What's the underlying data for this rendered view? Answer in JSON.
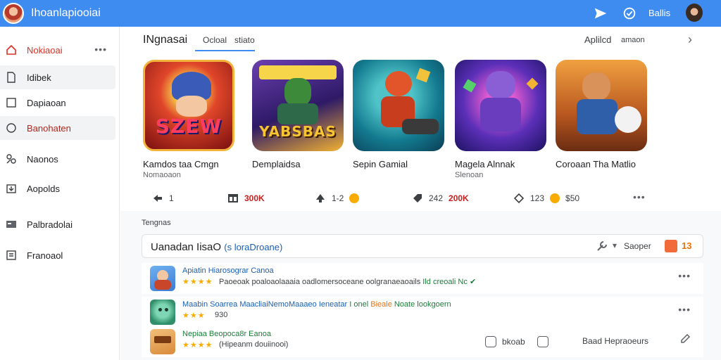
{
  "app": {
    "title": "Ihoanlapiooiai"
  },
  "topbar": {
    "label": "Ballis"
  },
  "sidebar": {
    "items": [
      {
        "label": "Nokiaoai",
        "icon": "home-icon"
      },
      {
        "label": "Idibek",
        "icon": "document-icon"
      },
      {
        "label": "Dapiaoan",
        "icon": "square-icon"
      },
      {
        "label": "Banohaten",
        "icon": "circle-icon"
      },
      {
        "label": "Naonos",
        "icon": "people-icon"
      },
      {
        "label": "Aopolds",
        "icon": "download-box-icon"
      },
      {
        "label": "Palbradolai",
        "icon": "card-icon"
      },
      {
        "label": "Franoaol",
        "icon": "list-box-icon"
      }
    ]
  },
  "main": {
    "section_title": "INgnasai",
    "tabs": [
      "Ocloal",
      "stiato"
    ],
    "right_links": [
      "Aplilcd",
      "amaon"
    ],
    "cards": [
      {
        "name": "Kamdos taa Cmgn",
        "sub": "Nomaoaon",
        "art": "SZEW",
        "colors": [
          "#b01818",
          "#f2a23a"
        ]
      },
      {
        "name": "Demplaidsa",
        "sub": "",
        "art": "YABSBAS",
        "colors": [
          "#4b2a8c",
          "#f7c531"
        ]
      },
      {
        "name": "Sepin Gamial",
        "sub": "",
        "art": "",
        "colors": [
          "#0c6e8e",
          "#f08b2a"
        ]
      },
      {
        "name": "Magela Alnnak",
        "sub": "Slenoan",
        "art": "",
        "colors": [
          "#3a1e8c",
          "#d54ab6"
        ]
      },
      {
        "name": "Coroaan Tha Matlio",
        "sub": "",
        "art": "",
        "colors": [
          "#d7762a",
          "#4a8bd6"
        ]
      }
    ],
    "stats": [
      {
        "icon": "arrow-icon",
        "value": "1",
        "color": "#3c4043"
      },
      {
        "icon": "grid-icon",
        "value": "300K",
        "color": "#c5221f"
      },
      {
        "icon": "up-arrow-icon",
        "value": "1-2",
        "color": "#3c4043"
      },
      {
        "icon": "tag-icon",
        "value": "242",
        "color": "#3c4043",
        "extra": "200K"
      },
      {
        "icon": "diamond-icon",
        "value": "123",
        "color": "#3c4043",
        "extra": "$50"
      }
    ],
    "list_label": "Tengnas",
    "search": {
      "text": "Uanadan IisaO",
      "hint": "(s loraDroane)",
      "tool_label": "Saoper",
      "count": "13"
    },
    "rows": [
      {
        "title": "Apiatin Hiarosograr Canoa",
        "stars": "★★★★",
        "desc": "Paoeoak poaloaolaaaia oadlomersoceane oolgranaeaoails",
        "desc_green": "Ild creoali Nc",
        "color": "#3d7bd4"
      },
      {
        "title": "Maabin Soarrea MaacliaiNemoMaaaeo Ieneatar",
        "title_green": "I onel",
        "title_orange": "Bieale",
        "title_tail": "Noate lookgoern",
        "stars": "★★★",
        "desc": "930",
        "color": "#2f8f6b"
      },
      {
        "title": "Nepiaa Beopoca8r Eanoa",
        "stars": "★★★★",
        "desc": "(Hipeanm douiinooi)",
        "actions": [
          "bkoab",
          "Baad Hepraoeurs"
        ],
        "color": "#d98a3a"
      }
    ]
  }
}
